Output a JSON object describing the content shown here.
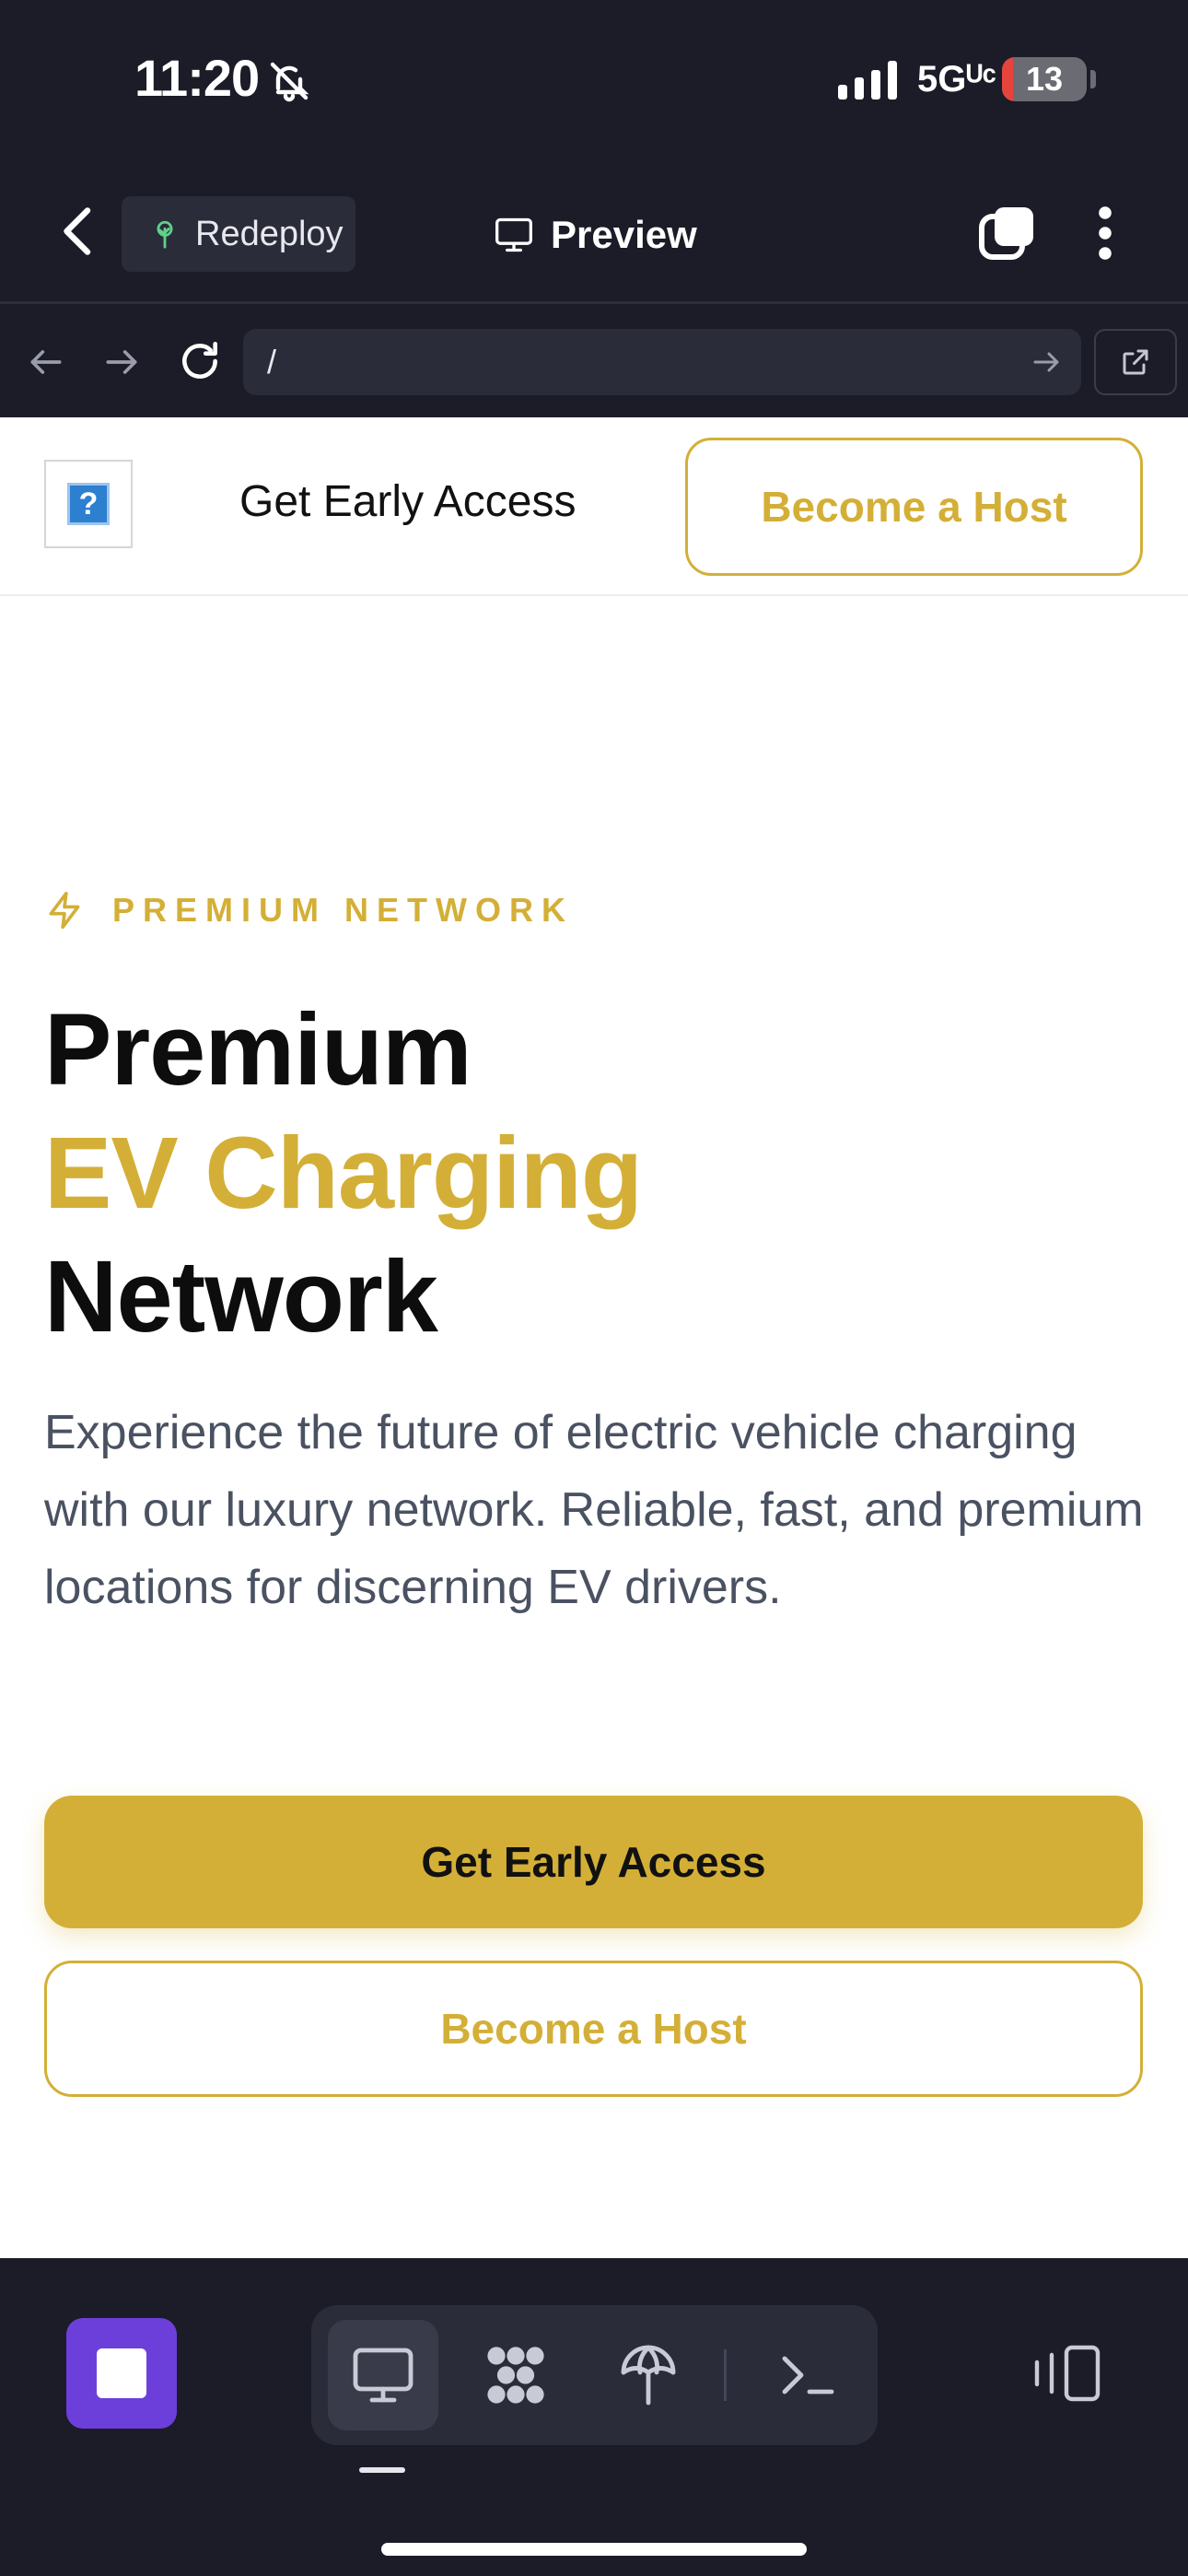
{
  "status_bar": {
    "time": "11:20",
    "network": "5Gᵁᶜ",
    "battery_level": "13",
    "battery_fraction": 0.13,
    "icons": [
      "bell-off-icon",
      "signal-icon"
    ]
  },
  "toolbar": {
    "redeploy_label": "Redeploy",
    "preview_label": "Preview",
    "icons": [
      "chevron-left-icon",
      "tree-icon",
      "monitor-icon",
      "tabs-icon",
      "more-vertical-icon"
    ]
  },
  "url_bar": {
    "value": "/",
    "icons": [
      "arrow-left-icon",
      "arrow-right-icon",
      "reload-icon",
      "go-arrow-icon",
      "external-link-icon"
    ]
  },
  "site": {
    "header": {
      "logo_alt": "?",
      "nav_early_access": "Get Early Access",
      "nav_become_host": "Become a Host"
    },
    "hero": {
      "eyebrow": "PREMIUM NETWORK",
      "title_line1": "Premium",
      "title_line2": "EV Charging",
      "title_line3": "Network",
      "description": "Experience the future of electric vehicle charging with our luxury network. Reliable, fast, and premium locations for discerning EV drivers.",
      "cta_primary": "Get Early Access",
      "cta_secondary": "Become a Host"
    },
    "colors": {
      "accent_gold": "#d4af37",
      "text_dark": "#0d0d0d",
      "text_muted": "#4a5262"
    }
  },
  "dock": {
    "icons": [
      "stop-icon",
      "desktop-icon",
      "apps-grid-icon",
      "deploy-icon",
      "terminal-icon",
      "split-view-icon"
    ],
    "colors": {
      "stop_button": "#6c3fdb",
      "background": "#1b1c27"
    }
  }
}
